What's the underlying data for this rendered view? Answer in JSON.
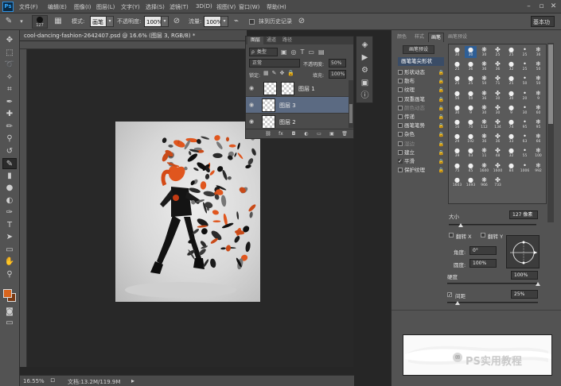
{
  "app": {
    "logo": "Ps"
  },
  "menus": [
    "文件(F)",
    "编辑(E)",
    "图像(I)",
    "图层(L)",
    "文字(Y)",
    "选择(S)",
    "滤镜(T)",
    "3D(D)",
    "视图(V)",
    "窗口(W)",
    "帮助(H)"
  ],
  "window_controls": {
    "minimize": "–",
    "restore": "▫",
    "close": "✕"
  },
  "options_bar": {
    "brush_size": "127",
    "mode_label": "模式:",
    "mode_value": "画笔",
    "opacity_label": "不透明度:",
    "opacity_value": "100%",
    "flow_label": "流量:",
    "flow_value": "100%",
    "erase_history_label": "抹到历史记录",
    "workspace": "基本功能"
  },
  "document": {
    "tab_title": "cool-dancing-fashion-2642407.psd @ 16.6% (图层 3, RGB/8) *",
    "zoom": "16.55%",
    "doc_info": "文档:13.2M/119.9M"
  },
  "layers_panel": {
    "tabs": [
      "图层",
      "通道",
      "路径"
    ],
    "filter_label": "类型",
    "blend_mode": "正常",
    "opacity_label": "不透明度:",
    "opacity_value": "50%",
    "lock_label": "锁定:",
    "fill_label": "填充:",
    "fill_value": "100%",
    "layers": [
      {
        "name": "图层 1",
        "selected": false
      },
      {
        "name": "图层 3",
        "selected": true
      },
      {
        "name": "图层 2",
        "selected": false
      }
    ],
    "bottom_icons": [
      "link-icon",
      "fx-icon",
      "mask-icon",
      "adjustment-icon",
      "group-icon",
      "new-layer-icon",
      "trash-icon"
    ]
  },
  "brush_panel": {
    "tabs": [
      "颜色",
      "样式",
      "画笔",
      "画笔预设"
    ],
    "preset_button": "画笔预设",
    "shape_header": "画笔笔尖形状",
    "items": [
      {
        "label": "形状动态",
        "checked": false,
        "dim": false
      },
      {
        "label": "散布",
        "checked": false,
        "dim": false
      },
      {
        "label": "纹理",
        "checked": false,
        "dim": false
      },
      {
        "label": "双重画笔",
        "checked": false,
        "dim": false
      },
      {
        "label": "颜色动态",
        "checked": false,
        "dim": true
      },
      {
        "label": "传递",
        "checked": false,
        "dim": false
      },
      {
        "label": "画笔笔势",
        "checked": false,
        "dim": false
      },
      {
        "label": "杂色",
        "checked": false,
        "dim": false
      },
      {
        "label": "湿边",
        "checked": false,
        "dim": true
      },
      {
        "label": "建立",
        "checked": false,
        "dim": false
      },
      {
        "label": "平滑",
        "checked": true,
        "dim": false
      },
      {
        "label": "保护纹理",
        "checked": false,
        "dim": false
      }
    ],
    "brush_numbers": [
      "30",
      "30",
      "30",
      "25",
      "25",
      "25",
      "36",
      "25",
      "36",
      "36",
      "36",
      "32",
      "25",
      "50",
      "25",
      "25",
      "50",
      "71",
      "25",
      "50",
      "50",
      "50",
      "50",
      "36",
      "30",
      "30",
      "20",
      "9",
      "30",
      "9",
      "30",
      "30",
      "9",
      "30",
      "60",
      "16",
      "70",
      "112",
      "134",
      "74",
      "95",
      "95",
      "29",
      "192",
      "36",
      "36",
      "33",
      "63",
      "66",
      "39",
      "63",
      "11",
      "48",
      "32",
      "55",
      "100",
      "75",
      "45",
      "1600",
      "1600",
      "84",
      "1006",
      "992",
      "1603",
      "1493",
      "966",
      "733"
    ],
    "size_label": "大小",
    "size_value": "127 像素",
    "flip_x": "翻转 X",
    "flip_y": "翻转 Y",
    "angle_label": "角度:",
    "angle_value": "0°",
    "roundness_label": "圆度:",
    "roundness_value": "100%",
    "hardness_label": "硬度",
    "hardness_value": "100%",
    "spacing_label": "间距",
    "spacing_value": "25%",
    "watermark": "PS实用教程"
  }
}
